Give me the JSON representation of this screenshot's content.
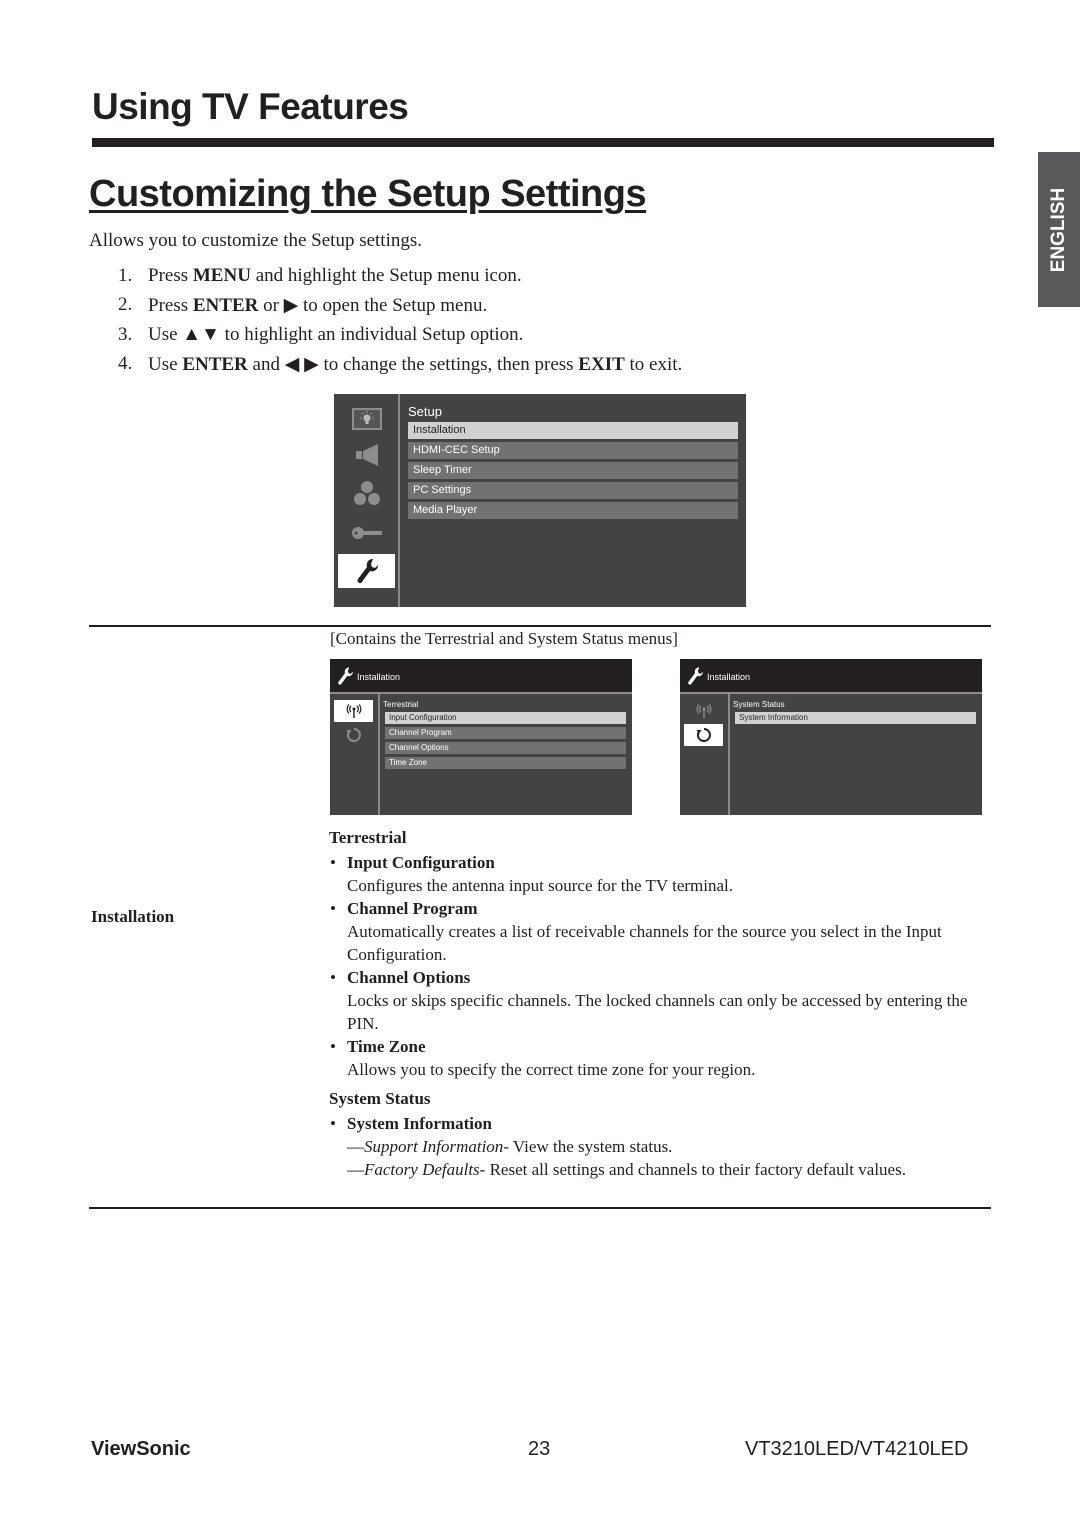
{
  "header": {
    "chapter_title": "Using TV Features",
    "section_title": "Customizing the Setup Settings",
    "language_tab": "ENGLISH"
  },
  "intro": "Allows you to customize the Setup settings.",
  "steps": [
    {
      "num": "1.",
      "parts": [
        {
          "t": "Press "
        },
        {
          "t": "MENU",
          "b": true
        },
        {
          "t": " and highlight the Setup menu icon."
        }
      ]
    },
    {
      "num": "2.",
      "parts": [
        {
          "t": "Press "
        },
        {
          "t": "ENTER",
          "b": true
        },
        {
          "t": " or ▶ to open the Setup menu."
        }
      ]
    },
    {
      "num": "3.",
      "parts": [
        {
          "t": "Use ▲▼ to highlight an individual Setup option."
        }
      ]
    },
    {
      "num": "4.",
      "parts": [
        {
          "t": "Use "
        },
        {
          "t": "ENTER",
          "b": true
        },
        {
          "t": " and ◀ ▶ to change the settings, then press "
        },
        {
          "t": "EXIT",
          "b": true
        },
        {
          "t": " to exit."
        }
      ]
    }
  ],
  "setup_osd": {
    "title": "Setup",
    "side_icons": [
      "picture-icon",
      "audio-icon",
      "channel-icon",
      "lock-icon",
      "setup-wrench-icon"
    ],
    "selected_icon": 4,
    "items": [
      "Installation",
      "HDMI-CEC Setup",
      "Sleep Timer",
      "PC Settings",
      "Media Player"
    ],
    "selected_item": 0
  },
  "caption": "[Contains the Terrestrial and System Status menus]",
  "installation_osd_left": {
    "header": "Installation",
    "category": "Terrestrial",
    "selected_icon": 0,
    "items": [
      "Input Configuration",
      "Channel Program",
      "Channel Options",
      "Time Zone"
    ],
    "selected_item": 0
  },
  "installation_osd_right": {
    "header": "Installation",
    "category": "System Status",
    "selected_icon": 1,
    "items": [
      "System Information"
    ],
    "selected_item": 0
  },
  "table": {
    "row_label": "Installation",
    "groups": [
      {
        "heading": "Terrestrial",
        "items": [
          {
            "title": "Input Configuration",
            "text": "Configures the antenna input source for the TV terminal."
          },
          {
            "title": "Channel Program",
            "text": "Automatically creates a list of receivable channels for the source you select in the Input Configuration."
          },
          {
            "title": "Channel Options",
            "text": "Locks or skips specific channels. The locked channels can only be accessed by entering the PIN."
          },
          {
            "title": "Time Zone",
            "text": "Allows you to specify the correct time zone for your region."
          }
        ]
      },
      {
        "heading": "System Status",
        "items": [
          {
            "title": "System Information",
            "subitems": [
              {
                "name": "Support Information",
                "text": "- View the system status."
              },
              {
                "name": "Factory Defaults",
                "text": "- Reset all settings and channels to their factory default values."
              }
            ]
          }
        ]
      }
    ]
  },
  "footer": {
    "brand": "ViewSonic",
    "page_number": "23",
    "model": "VT3210LED/VT4210LED"
  }
}
